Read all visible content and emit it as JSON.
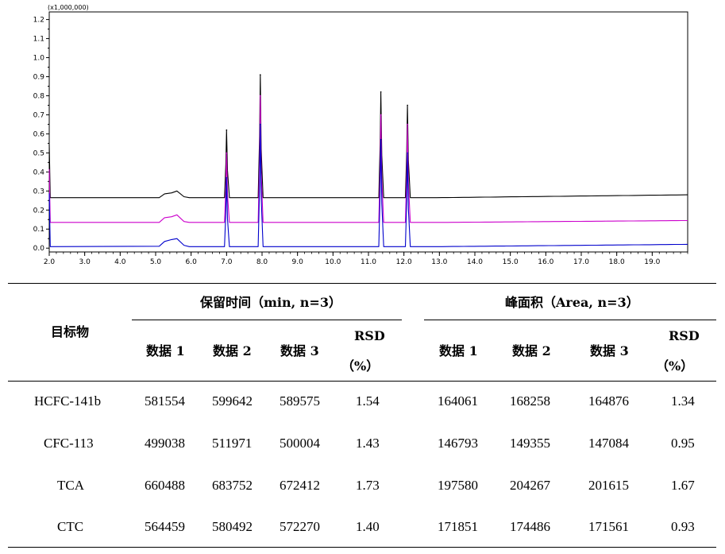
{
  "chart_data": {
    "type": "line",
    "scale_label": "(x1,000,000)",
    "xlim": [
      2.0,
      20.0
    ],
    "ylim": [
      -0.02,
      1.24
    ],
    "x_ticks": [
      "2.0",
      "3.0",
      "4.0",
      "5.0",
      "6.0",
      "7.0",
      "8.0",
      "9.0",
      "10.0",
      "11.0",
      "12.0",
      "13.0",
      "14.0",
      "15.0",
      "16.0",
      "17.0",
      "18.0",
      "19.0"
    ],
    "y_ticks": [
      "0.0",
      "0.1",
      "0.2",
      "0.3",
      "0.4",
      "0.5",
      "0.6",
      "0.7",
      "0.8",
      "0.9",
      "1.0",
      "1.1",
      "1.2"
    ],
    "grid": false,
    "series": [
      {
        "color": "#000000",
        "baseline": 0.265,
        "end_level": 0.28,
        "hump": [
          [
            5.1,
            0.265
          ],
          [
            5.25,
            0.285
          ],
          [
            5.45,
            0.29
          ],
          [
            5.6,
            0.3
          ],
          [
            5.8,
            0.27
          ]
        ],
        "peaks": [
          [
            7.0,
            0.62
          ],
          [
            7.95,
            0.91
          ],
          [
            11.35,
            0.82
          ],
          [
            12.1,
            0.75
          ]
        ]
      },
      {
        "color": "#cc00cc",
        "baseline": 0.135,
        "end_level": 0.145,
        "hump": [
          [
            5.1,
            0.135
          ],
          [
            5.25,
            0.16
          ],
          [
            5.45,
            0.165
          ],
          [
            5.6,
            0.175
          ],
          [
            5.8,
            0.14
          ]
        ],
        "peaks": [
          [
            7.0,
            0.5
          ],
          [
            7.95,
            0.8
          ],
          [
            11.35,
            0.7
          ],
          [
            12.1,
            0.65
          ]
        ]
      },
      {
        "color": "#0000cc",
        "baseline": 0.008,
        "end_level": 0.02,
        "hump": [
          [
            5.1,
            0.01
          ],
          [
            5.25,
            0.035
          ],
          [
            5.45,
            0.045
          ],
          [
            5.6,
            0.05
          ],
          [
            5.8,
            0.015
          ]
        ],
        "peaks": [
          [
            7.0,
            0.37
          ],
          [
            7.95,
            0.65
          ],
          [
            11.35,
            0.57
          ],
          [
            12.1,
            0.5
          ]
        ]
      }
    ]
  },
  "table": {
    "target_header": "目标物",
    "rt_group_header": "保留时间（min, n=3）",
    "area_group_header": "峰面积（Area, n=3）",
    "sub_headers": [
      "数据 1",
      "数据 2",
      "数据 3"
    ],
    "rsd_label": "RSD",
    "rsd_unit": "（%）",
    "rows": [
      {
        "name": "HCFC-141b",
        "rt": [
          "581554",
          "599642",
          "589575"
        ],
        "rt_rsd": "1.54",
        "area": [
          "164061",
          "168258",
          "164876"
        ],
        "area_rsd": "1.34"
      },
      {
        "name": "CFC-113",
        "rt": [
          "499038",
          "511971",
          "500004"
        ],
        "rt_rsd": "1.43",
        "area": [
          "146793",
          "149355",
          "147084"
        ],
        "area_rsd": "0.95"
      },
      {
        "name": "TCA",
        "rt": [
          "660488",
          "683752",
          "672412"
        ],
        "rt_rsd": "1.73",
        "area": [
          "197580",
          "204267",
          "201615"
        ],
        "area_rsd": "1.67"
      },
      {
        "name": "CTC",
        "rt": [
          "564459",
          "580492",
          "572270"
        ],
        "rt_rsd": "1.40",
        "area": [
          "171851",
          "174486",
          "171561"
        ],
        "area_rsd": "0.93"
      }
    ]
  }
}
